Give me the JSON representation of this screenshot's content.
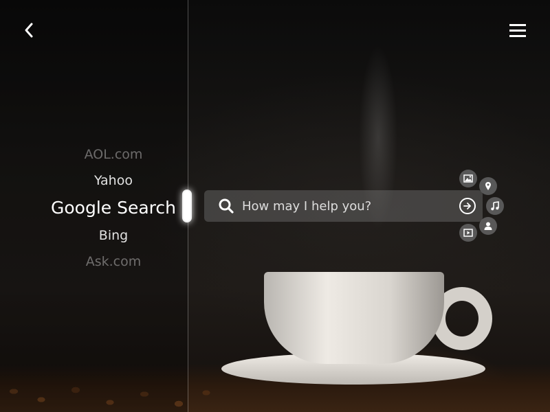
{
  "header": {
    "back_icon": "chevron-left-icon",
    "menu_icon": "hamburger-menu-icon"
  },
  "engines": {
    "items": [
      {
        "label": "AOL.com",
        "state": "far"
      },
      {
        "label": "Yahoo",
        "state": "near"
      },
      {
        "label": "Google Search",
        "state": "active"
      },
      {
        "label": "Bing",
        "state": "near"
      },
      {
        "label": "Ask.com",
        "state": "far"
      }
    ],
    "selected": "Google Search"
  },
  "search": {
    "placeholder": "How may I help you?",
    "value": "",
    "icon": "search-icon",
    "submit_icon": "arrow-right-circle-icon"
  },
  "media_filters": [
    {
      "name": "image",
      "icon": "image-icon"
    },
    {
      "name": "location",
      "icon": "map-pin-icon"
    },
    {
      "name": "music",
      "icon": "music-note-icon"
    },
    {
      "name": "person",
      "icon": "person-icon"
    },
    {
      "name": "video",
      "icon": "video-icon"
    }
  ],
  "colors": {
    "background": "#0d0c0b",
    "search_bar": "#787878",
    "text": "#ffffff",
    "muted_text": "#8a8a8a"
  }
}
